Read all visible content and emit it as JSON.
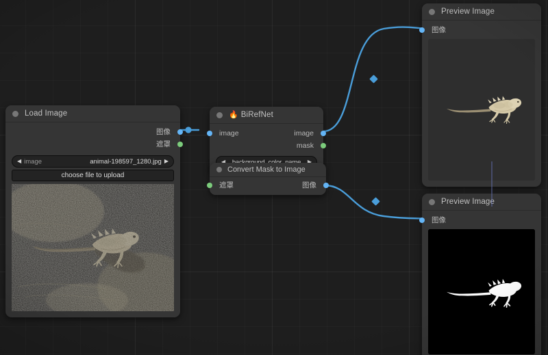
{
  "app": {
    "name": "ComfyUI Node Graph",
    "canvas_background": "#1e1e1e",
    "link_color": "#4a9eda",
    "accent_image_port": "#64b5f6",
    "accent_mask_port": "#7ccc7c"
  },
  "nodes": {
    "load_image": {
      "title": "Load Image",
      "outputs": [
        {
          "label": "图像",
          "type": "IMAGE",
          "color": "#64b5f6"
        },
        {
          "label": "遮罩",
          "type": "MASK",
          "color": "#7ccc7c"
        }
      ],
      "widgets": {
        "image_combo": {
          "key": "image",
          "value": "animal-198597_1280.jpg",
          "left_arrow": "◀",
          "right_arrow": "▶"
        },
        "upload_button": "choose file to upload"
      },
      "preview_alt": "lizard on sand"
    },
    "birefnet": {
      "title": "BiRefNet",
      "title_icon": "🔥",
      "inputs": [
        {
          "label": "image",
          "type": "IMAGE",
          "color": "#64b5f6"
        }
      ],
      "outputs": [
        {
          "label": "image",
          "type": "IMAGE",
          "color": "#64b5f6"
        },
        {
          "label": "mask",
          "type": "MASK",
          "color": "#7ccc7c"
        }
      ],
      "widgets": {
        "background_color_combo": {
          "value": "background_color_name",
          "left_arrow": "◀",
          "right_arrow": "▶"
        }
      }
    },
    "convert_mask_to_image": {
      "title": "Convert Mask to Image",
      "inputs": [
        {
          "label": "遮罩",
          "type": "MASK",
          "color": "#7ccc7c"
        }
      ],
      "outputs": [
        {
          "label": "图像",
          "type": "IMAGE",
          "color": "#64b5f6"
        }
      ]
    },
    "preview_image_top": {
      "title": "Preview Image",
      "inputs": [
        {
          "label": "图像",
          "type": "IMAGE",
          "color": "#64b5f6"
        }
      ],
      "preview_alt": "lizard cut out on transparent background"
    },
    "preview_image_bottom": {
      "title": "Preview Image",
      "inputs": [
        {
          "label": "图像",
          "type": "IMAGE",
          "color": "#64b5f6"
        }
      ],
      "preview_alt": "white lizard silhouette mask on black"
    }
  }
}
